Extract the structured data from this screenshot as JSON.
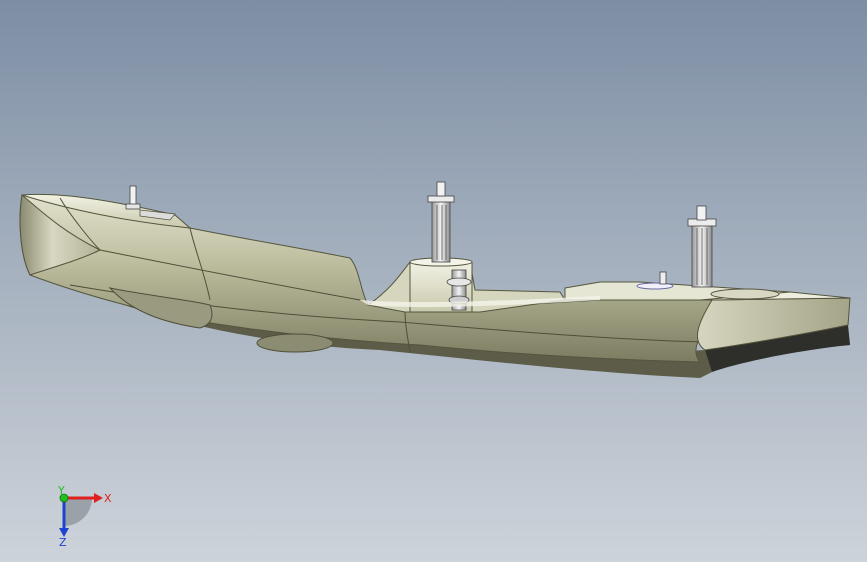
{
  "viewport": {
    "background_top": "#7d8ea4",
    "background_bottom": "#cdd3da"
  },
  "model": {
    "icon": "ship-hull-3d-model",
    "hull_color": "#c8c8a8",
    "hull_shadow": "#6f6f58",
    "bottom_color": "#2e2e2a"
  },
  "triad": {
    "x_label": "X",
    "y_label": "Y",
    "z_label": "Z",
    "x_color": "#e02020",
    "y_color": "#20c020",
    "z_color": "#2040d0"
  }
}
